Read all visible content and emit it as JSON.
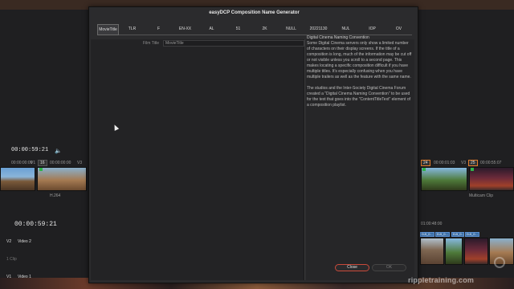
{
  "dialog": {
    "title": "easyDCP Composition Name Generator",
    "tokens": [
      {
        "label": "MovieTitle",
        "active": true
      },
      {
        "label": "TLR"
      },
      {
        "label": "F"
      },
      {
        "label": "EN-XX"
      },
      {
        "label": "AL"
      },
      {
        "label": "51"
      },
      {
        "label": "2K"
      },
      {
        "label": "NULL"
      },
      {
        "label": "20221130"
      },
      {
        "label": "NUL"
      },
      {
        "label": "IOP"
      },
      {
        "label": "OV"
      }
    ],
    "film_title": {
      "label": "Film Title",
      "value": "MovieTitle"
    },
    "info": {
      "heading": "Digital Cinema Naming Convention",
      "paragraph1": "Some Digital Cinema servers only show a limited number of characters on their display screens. If the title of a composition is long, much of the information may be cut off or not visible unless you scroll to a second page. This makes locating a specific composition difficult if you have multiple titles. It's especially confusing when you have multiple trailers as well as the feature with the same name.",
      "paragraph2": "The studios and the Inter-Society Digital Cinema Forum created a \"Digital Cinema Naming Convention\" to be used for the text that goes into the \"ContentTitleText\" element of a composition playlist."
    },
    "buttons": {
      "close": "Close",
      "ok": "OK"
    }
  },
  "background": {
    "viewer_timecode": "00:00:59:21",
    "timeline_timecode": "00:00:59:21",
    "left_strip": {
      "tc1": "00:00:00:00",
      "v1": "V1",
      "badge": "16",
      "tc2": "00:00:00:00",
      "v3": "V3",
      "codec": "H.264"
    },
    "right_strip": {
      "badge1": "24",
      "tc1": "00:00:01:03",
      "v1": "V3",
      "badge2": "25",
      "tc2": "00:00:55:07",
      "clip_name": "Multicam Clip"
    },
    "tracks": [
      {
        "id": "V2",
        "name": "Video 2",
        "clips": "1 Clip"
      },
      {
        "id": "V1",
        "name": "Video 1"
      }
    ],
    "ruler_tc": "01:00:48:00",
    "timeline_clips": [
      "DJI_0...",
      "DJI_0...",
      "DJI_0...",
      "DJI_0..."
    ],
    "watermark": "rippletraining.com"
  }
}
